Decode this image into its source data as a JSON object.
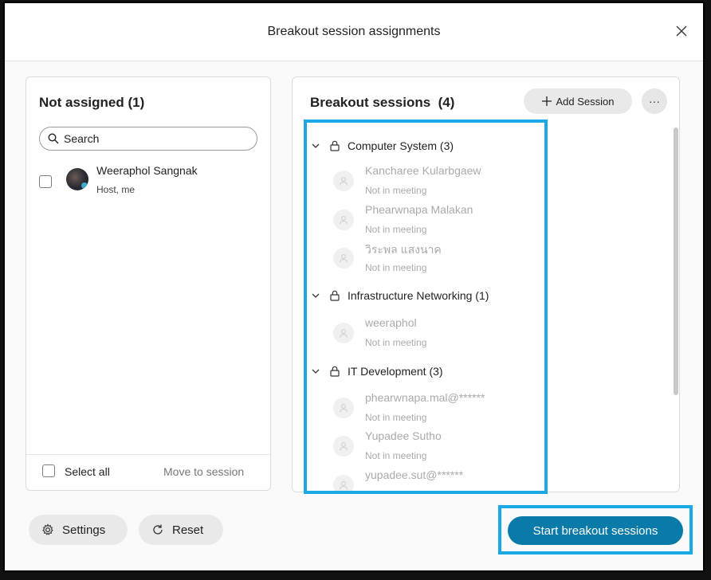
{
  "dialog": {
    "title": "Breakout session assignments"
  },
  "not_assigned": {
    "title": "Not assigned (1)",
    "search_placeholder": "Search",
    "users": [
      {
        "name": "Weeraphol Sangnak",
        "role": "Host, me"
      }
    ],
    "select_all_label": "Select all",
    "move_label": "Move to session"
  },
  "breakout": {
    "title": "Breakout sessions",
    "count": "(4)",
    "add_session_label": "Add Session",
    "more_label": "···",
    "sessions": [
      {
        "name": "Computer System (3)",
        "members": [
          {
            "name": "Kancharee Kularbgaew",
            "status": "Not in meeting"
          },
          {
            "name": "Phearwnapa Malakan",
            "status": "Not in meeting"
          },
          {
            "name": "วิระพล แสงนาค",
            "status": "Not in meeting"
          }
        ]
      },
      {
        "name": "Infrastructure Networking (1)",
        "members": [
          {
            "name": "weeraphol",
            "status": "Not in meeting"
          }
        ]
      },
      {
        "name": "IT Development (3)",
        "members": [
          {
            "name": "phearwnapa.mal@******",
            "status": "Not in meeting"
          },
          {
            "name": "Yupadee Sutho",
            "status": "Not in meeting"
          },
          {
            "name": "yupadee.sut@******",
            "status": ""
          }
        ]
      }
    ]
  },
  "footer": {
    "settings_label": "Settings",
    "reset_label": "Reset",
    "start_label": "Start breakout sessions"
  },
  "colors": {
    "accent": "#0a7aa8",
    "highlight": "#1ba9e6"
  }
}
